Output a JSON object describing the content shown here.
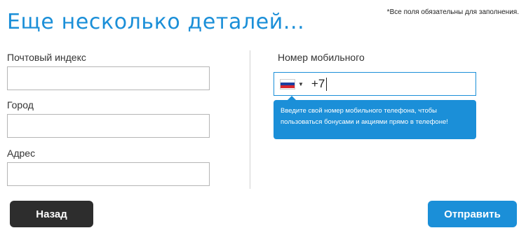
{
  "header": {
    "title": "Еще несколько деталей...",
    "required_note": "*Все поля обязательны для заполнения."
  },
  "form": {
    "postal_code": {
      "label": "Почтовый индекс",
      "value": ""
    },
    "city": {
      "label": "Город",
      "value": ""
    },
    "address": {
      "label": "Адрес",
      "value": ""
    },
    "phone": {
      "label": "Номер мобильного",
      "country_flag": "russia-flag-icon",
      "value": "+7",
      "hint": "Введите свой номер мобильного телефона, чтобы пользоваться бонусами и акциями прямо в телефоне!"
    }
  },
  "actions": {
    "back_label": "Назад",
    "submit_label": "Отправить"
  },
  "colors": {
    "accent": "#1b8fd8",
    "back_button": "#2d2d2d"
  }
}
